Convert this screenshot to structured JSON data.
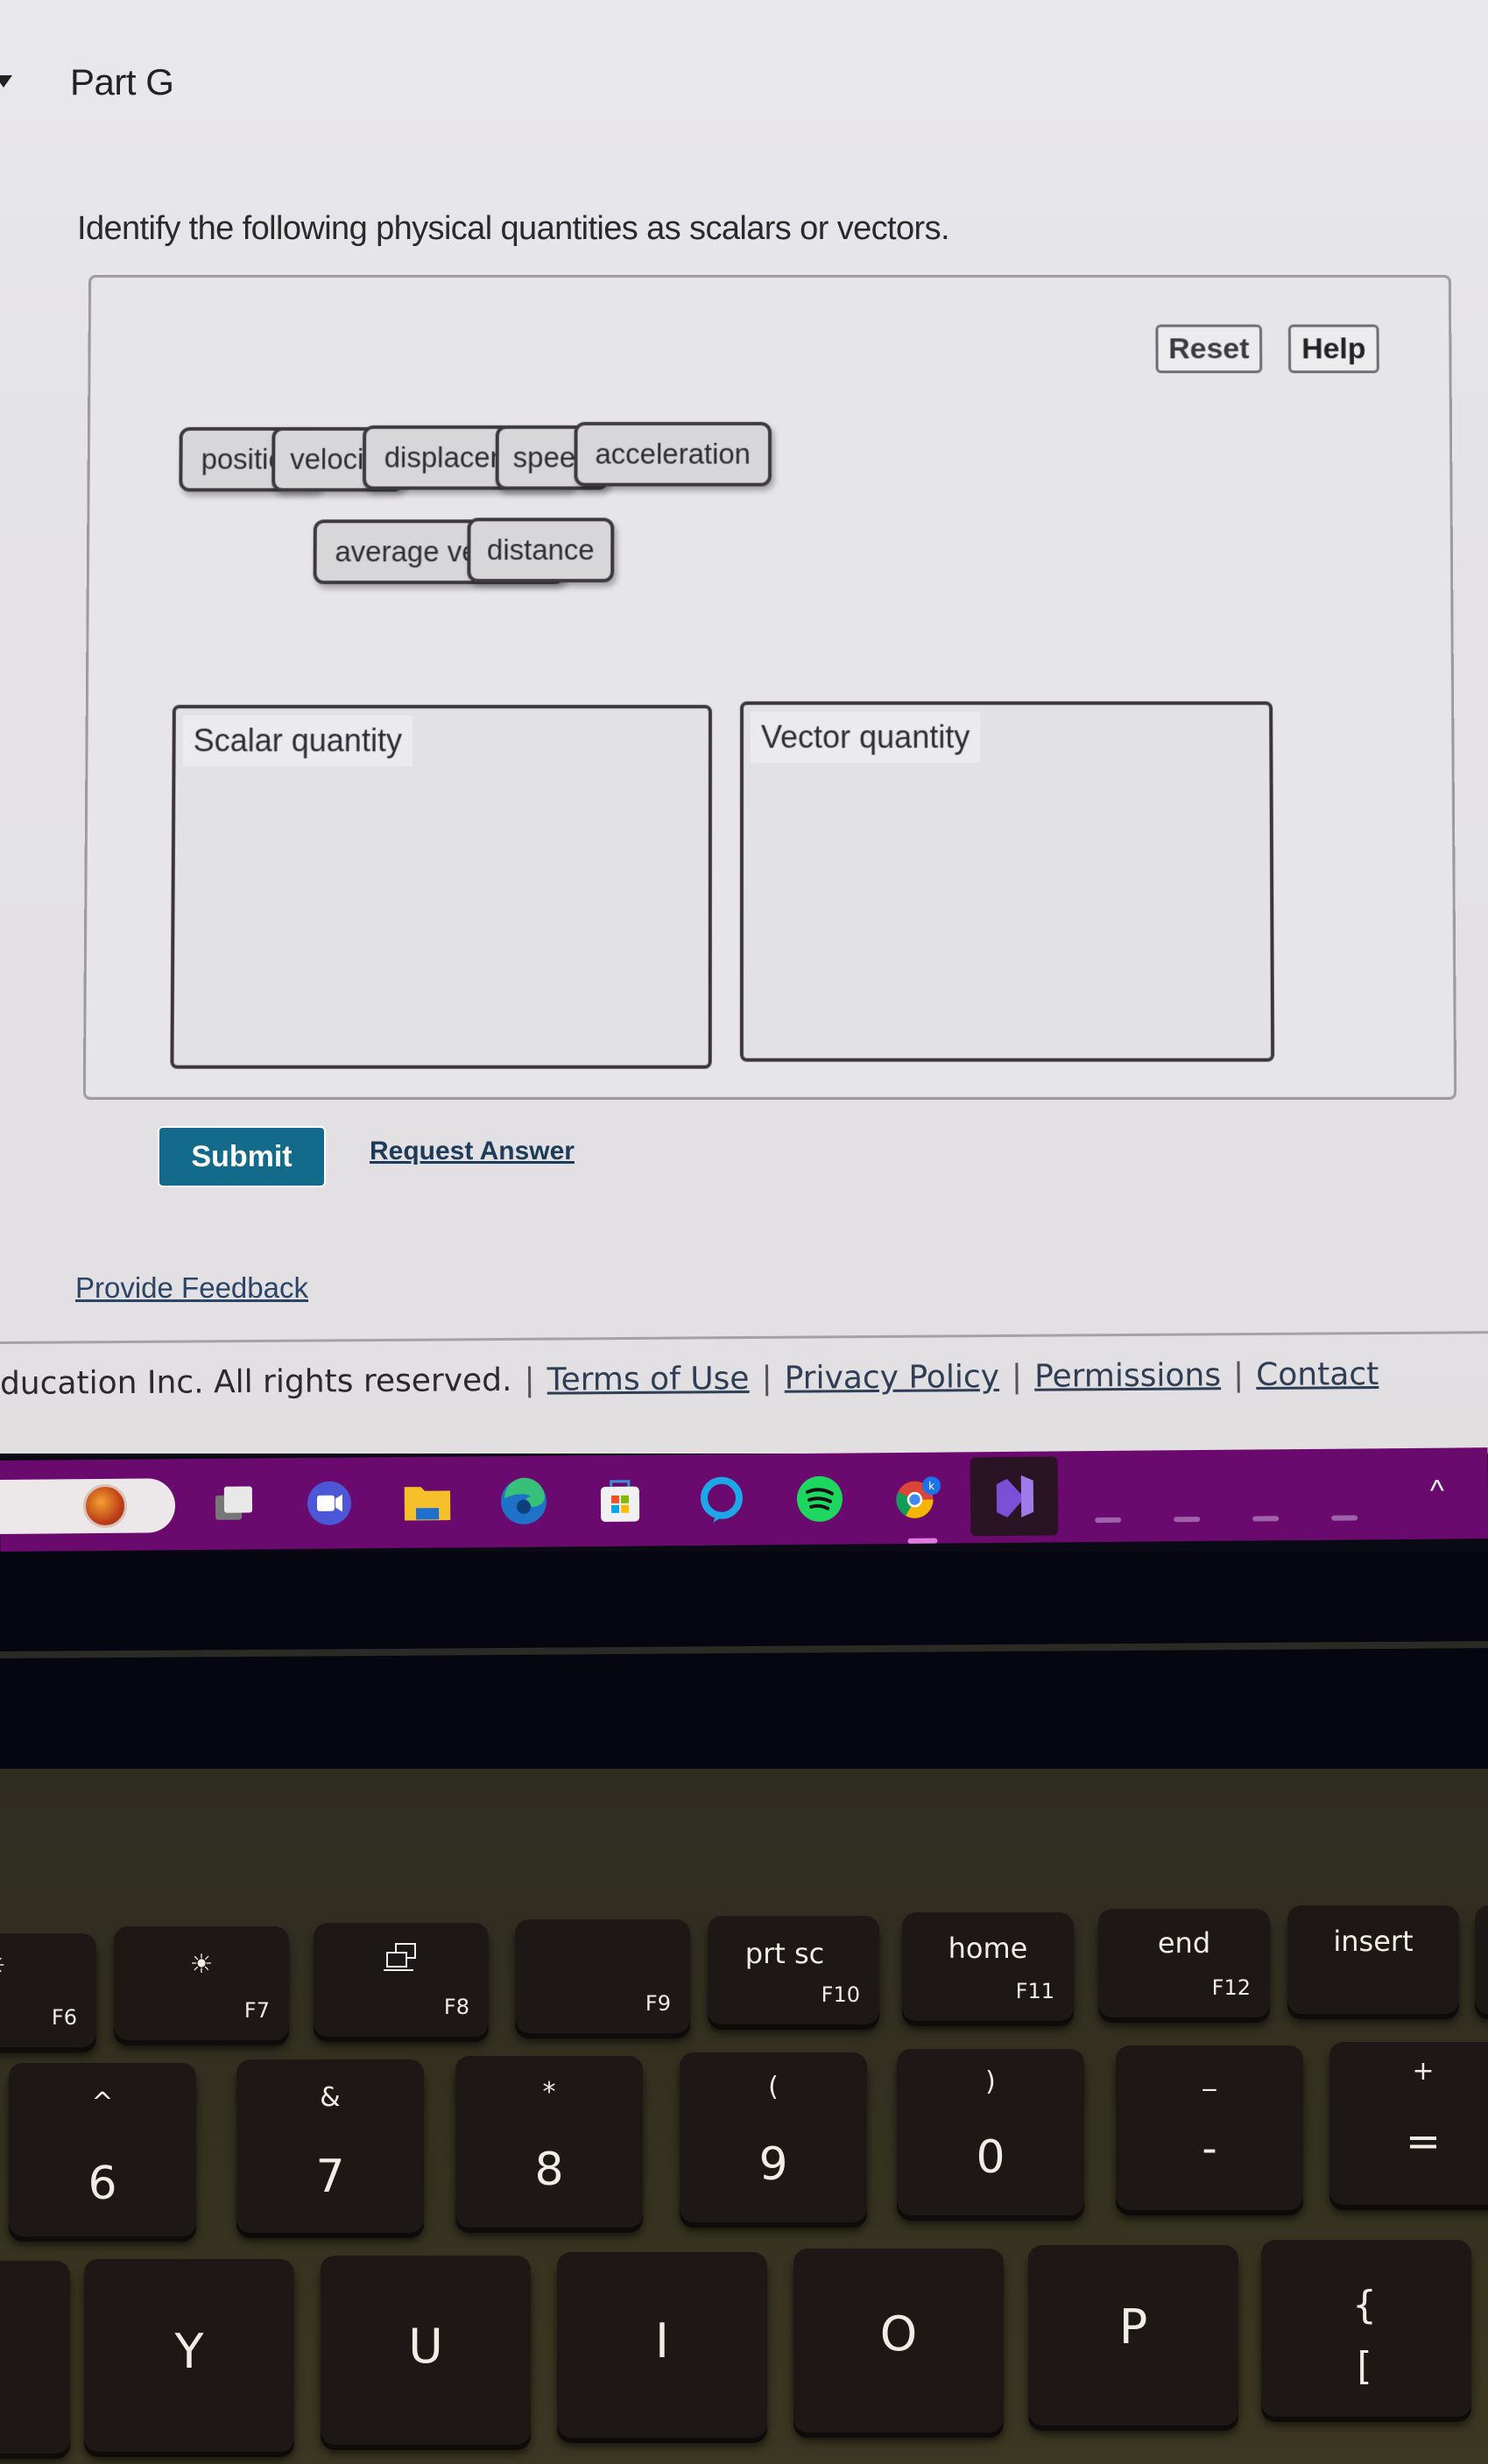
{
  "part": {
    "title": "Part G",
    "instructions": "Identify the following physical quantities as scalars or vectors."
  },
  "panel": {
    "reset_label": "Reset",
    "help_label": "Help",
    "chips": [
      "position",
      "velocity",
      "displacement",
      "speed",
      "acceleration",
      "average velocity",
      "distance"
    ],
    "bins": {
      "scalar": {
        "label": "Scalar quantity",
        "items": []
      },
      "vector": {
        "label": "Vector quantity",
        "items": []
      }
    }
  },
  "actions": {
    "submit_label": "Submit",
    "request_answer_label": "Request Answer",
    "provide_feedback_label": "Provide Feedback"
  },
  "footer": {
    "copyright": "ducation Inc. All rights reserved.",
    "separator": "|",
    "links": [
      "Terms of Use",
      "Privacy Policy",
      "Permissions",
      "Contact"
    ]
  },
  "taskbar": {
    "icons": [
      "widgets-weather-icon",
      "task-view-icon",
      "zoom-meetings-icon",
      "file-explorer-icon",
      "edge-icon",
      "microsoft-store-icon",
      "alexa-icon",
      "spotify-icon",
      "chrome-profile-icon",
      "visual-studio-icon"
    ],
    "active_app": "chrome-profile-icon",
    "tray_chevron": "^"
  },
  "colors": {
    "submit": "#136a8a",
    "taskbar": "#6b0a6e",
    "link": "#1f3b5a"
  },
  "keyboard": {
    "function_row": [
      {
        "label": "",
        "fn": "F6"
      },
      {
        "label": "",
        "fn": "F7"
      },
      {
        "label": "",
        "fn": "F8"
      },
      {
        "label": "",
        "fn": "F9"
      },
      {
        "label": "prt sc",
        "fn": "F10"
      },
      {
        "label": "home",
        "fn": "F11"
      },
      {
        "label": "end",
        "fn": "F12"
      },
      {
        "label": "insert",
        "fn": ""
      }
    ],
    "number_row": [
      {
        "shift": "^",
        "main": "6"
      },
      {
        "shift": "&",
        "main": "7"
      },
      {
        "shift": "*",
        "main": "8"
      },
      {
        "shift": "(",
        "main": "9"
      },
      {
        "shift": ")",
        "main": "0"
      },
      {
        "shift": "_",
        "main": "-"
      },
      {
        "shift": "+",
        "main": "="
      }
    ],
    "letter_row": [
      "Y",
      "U",
      "I",
      "O",
      "P",
      "{ ["
    ]
  }
}
